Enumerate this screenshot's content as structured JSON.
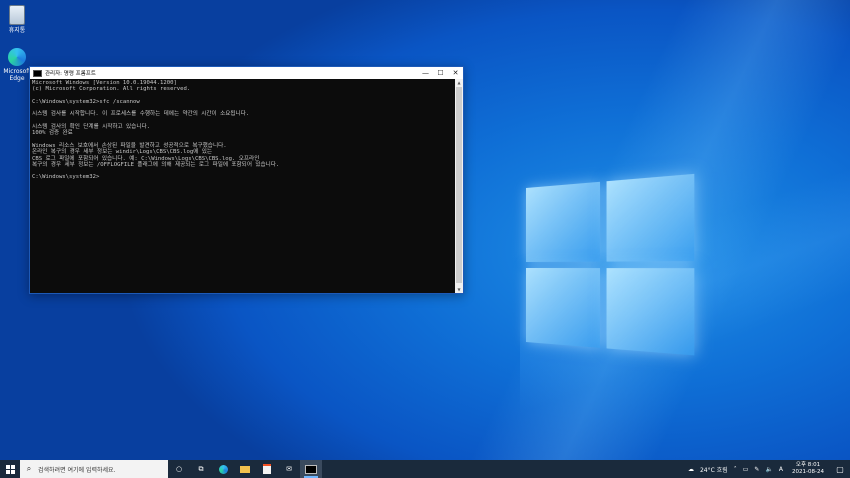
{
  "desktop": {
    "icons": [
      {
        "label": "휴지통"
      },
      {
        "label": "Microsoft Edge"
      }
    ]
  },
  "cmd_window": {
    "title": "관리자: 명령 프롬프트",
    "lines": [
      "Microsoft Windows [Version 10.0.19044.1200]",
      "(c) Microsoft Corporation. All rights reserved.",
      "",
      "C:\\Windows\\system32>sfc /scannow",
      "",
      "시스템 검사를 시작합니다. 이 프로세스를 수행하는 데에는 약간의 시간이 소요됩니다.",
      "",
      "시스템 검사의 확인 단계를 시작하고 있습니다.",
      "100% 검증 완료",
      "",
      "Windows 리소스 보호에서 손상된 파일을 발견하고 성공적으로 복구했습니다.",
      "온라인 복구의 경우 세부 정보는 windir\\Logs\\CBS\\CBS.log에 있는",
      "CBS 로그 파일에 포함되어 있습니다. 예: C:\\Windows\\Logs\\CBS\\CBS.log. 오프라인",
      "복구의 경우 세부 정보는 /OFFLOGFILE 플래그에 의해 제공되는 로그 파일에 포함되어 있습니다.",
      "",
      "C:\\Windows\\system32>"
    ],
    "buttons": {
      "minimize": "—",
      "maximize": "☐",
      "close": "✕"
    }
  },
  "taskbar": {
    "search_placeholder": "검색하려면 여기에 입력하세요.",
    "weather": "24°C 흐림",
    "ime": "A",
    "time": "오후 8:01",
    "date": "2021-08-24"
  },
  "colors": {
    "accent": "#0a55c4",
    "console_bg": "#0c0c0c",
    "console_fg": "#c8c8c8"
  }
}
